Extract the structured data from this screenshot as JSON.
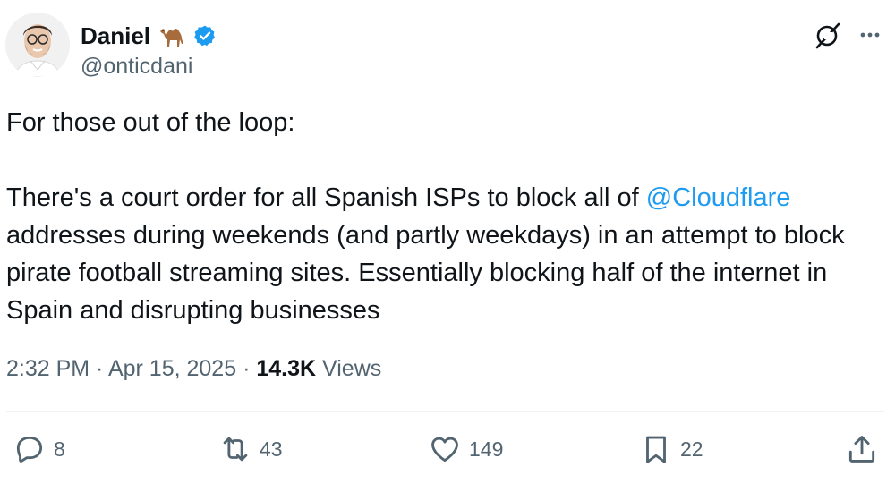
{
  "author": {
    "display_name": "Daniel",
    "emoji_icon": "camel-icon",
    "verified": true,
    "handle": "@onticdani"
  },
  "tweet": {
    "line_intro": "For those out of the loop:",
    "body_before_mention": "There's a court order for all Spanish ISPs to block all of ",
    "mention": "@Cloudflare",
    "body_after_mention": " addresses during weekends (and partly weekdays) in an attempt to block pirate football streaming sites. Essentially blocking half of the internet in Spain and disrupting businesses"
  },
  "meta": {
    "time": "2:32 PM",
    "date": "Apr 15, 2025",
    "separator": " · ",
    "views_count": "14.3K",
    "views_label": "Views"
  },
  "actions": {
    "reply_count": "8",
    "repost_count": "43",
    "like_count": "149",
    "bookmark_count": "22"
  },
  "colors": {
    "accent": "#1d9bf0",
    "text": "#0f1419",
    "secondary": "#536471"
  }
}
